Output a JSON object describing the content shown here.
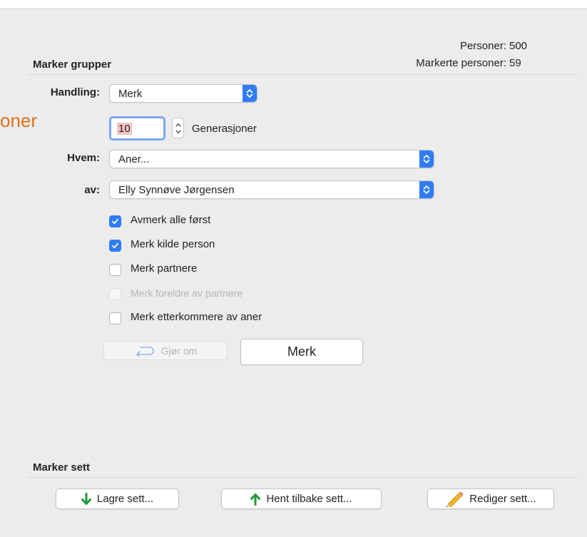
{
  "partial_heading": "oner",
  "stats": {
    "persons_label": "Personer:",
    "persons_value": "500",
    "marked_label": "Markerte personer:",
    "marked_value": "59"
  },
  "group_section": {
    "title": "Marker grupper",
    "action_label": "Handling:",
    "action_value": "Merk",
    "generations_value": "10",
    "generations_label": "Generasjoner",
    "who_label": "Hvem:",
    "who_value": "Aner...",
    "of_label": "av:",
    "of_value": "Elly Synnøve Jørgensen",
    "checkboxes": [
      {
        "label": "Avmerk alle først",
        "checked": true,
        "enabled": true
      },
      {
        "label": "Merk kilde person",
        "checked": true,
        "enabled": true
      },
      {
        "label": "Merk partnere",
        "checked": false,
        "enabled": true
      },
      {
        "label": "Merk foreldre av partnere",
        "checked": false,
        "enabled": false
      },
      {
        "label": "Merk etterkommere av aner",
        "checked": false,
        "enabled": true
      }
    ],
    "undo_label": "Gjør om",
    "mark_label": "Merk"
  },
  "set_section": {
    "title": "Marker sett",
    "save_label": "Lagre sett...",
    "load_label": "Hent tilbake sett...",
    "edit_label": "Rediger sett..."
  },
  "colors": {
    "accent": "#2f7cf6",
    "orange_text": "#e0711d",
    "save_arrow": "#1f9a3a",
    "load_arrow": "#1f9a3a"
  }
}
